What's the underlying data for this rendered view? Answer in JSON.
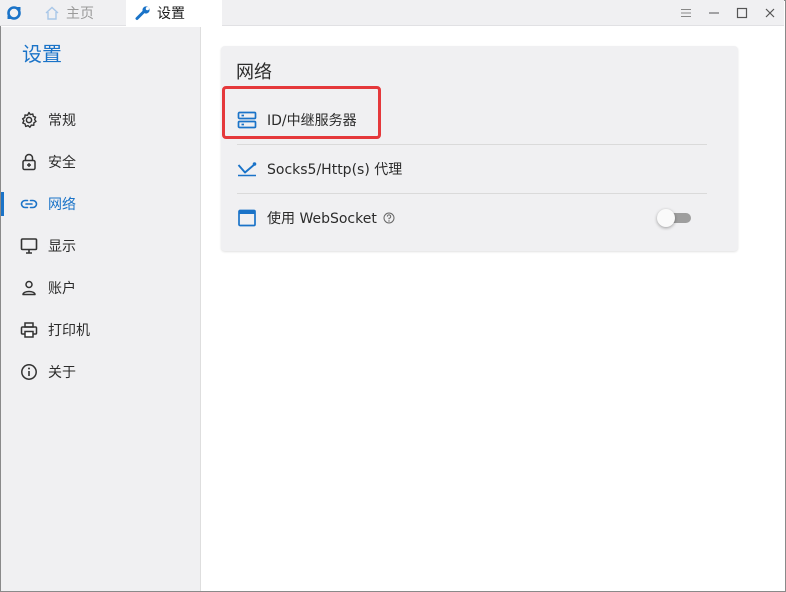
{
  "colors": {
    "accent": "#1a73c8",
    "highlight": "#e5383b"
  },
  "tabs": [
    {
      "label": "主页",
      "icon": "home-icon",
      "active": false
    },
    {
      "label": "设置",
      "icon": "wrench-icon",
      "active": true
    }
  ],
  "window_controls": [
    "menu-icon",
    "minimize-icon",
    "maximize-icon",
    "close-icon"
  ],
  "sidebar": {
    "title": "设置",
    "items": [
      {
        "label": "常规",
        "icon": "gear-icon"
      },
      {
        "label": "安全",
        "icon": "lock-icon"
      },
      {
        "label": "网络",
        "icon": "link-icon",
        "active": true
      },
      {
        "label": "显示",
        "icon": "monitor-icon"
      },
      {
        "label": "账户",
        "icon": "user-icon"
      },
      {
        "label": "打印机",
        "icon": "printer-icon"
      },
      {
        "label": "关于",
        "icon": "info-icon"
      }
    ]
  },
  "network": {
    "title": "网络",
    "relay_label": "ID/中继服务器",
    "proxy_label": "Socks5/Http(s) 代理",
    "websocket_label": "使用 WebSocket",
    "websocket_enabled": false
  }
}
